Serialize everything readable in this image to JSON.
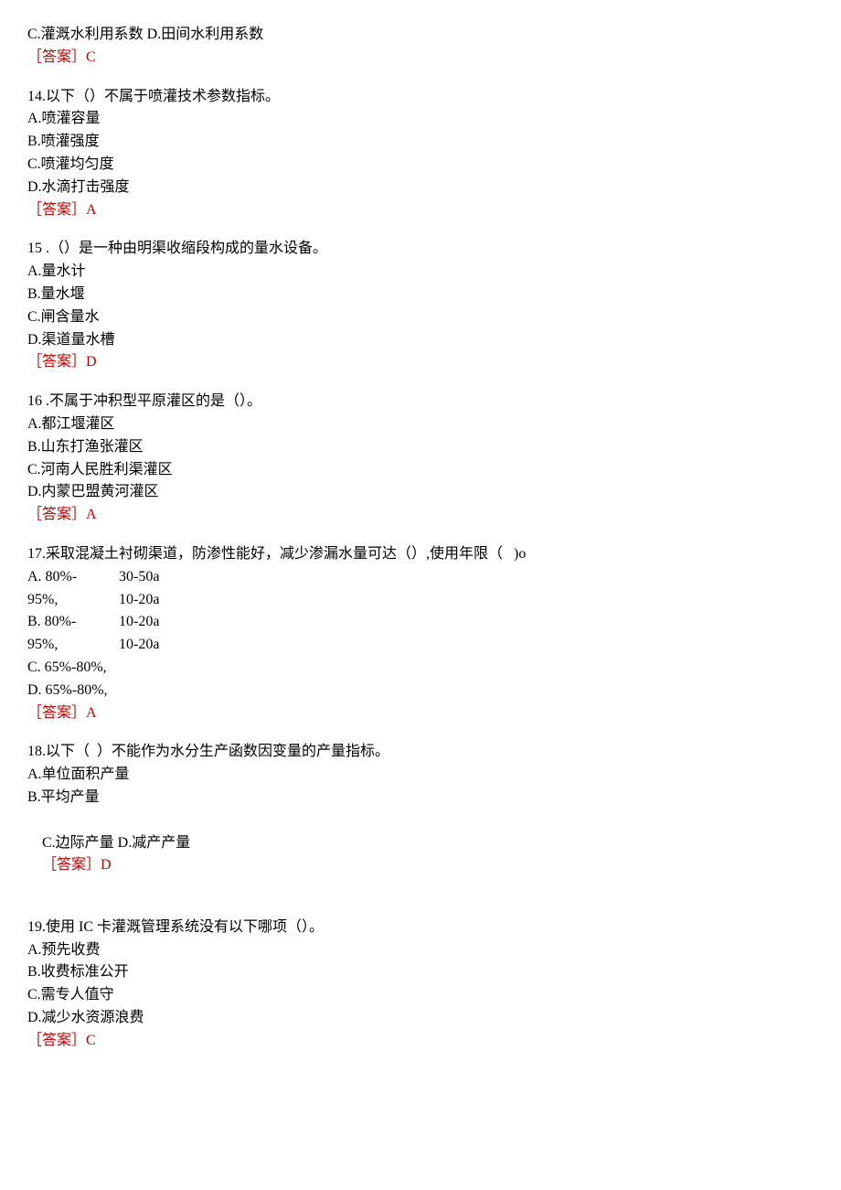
{
  "q13_tail": {
    "line_cd": "C.灌溉水利用系数 D.田间水利用系数",
    "answer": "［答案］C"
  },
  "q14": {
    "stem": "14.以下（）不属于喷灌技术参数指标。",
    "a": "A.喷灌容量",
    "b": "B.喷灌强度",
    "c": "C.喷灌均匀度",
    "d": "D.水滴打击强度",
    "answer": "［答案］A"
  },
  "q15": {
    "stem": "15 .（）是一种由明渠收缩段构成的量水设备。",
    "a": "A.量水计",
    "b": "B.量水堰",
    "c": "C.闸含量水",
    "d": "D.渠道量水槽",
    "answer": "［答案］D"
  },
  "q16": {
    "stem": "16 .不属于冲积型平原灌区的是（）。",
    "a": "A.都江堰灌区",
    "b": "B.山东打渔张灌区",
    "c": "C.河南人民胜利渠灌区",
    "d": "D.内蒙巴盟黄河灌区",
    "answer": "［答案］A"
  },
  "q17": {
    "stem": "17.采取混凝土衬砌渠道，防渗性能好，减少渗漏水量可达（）,使用年限（   )o",
    "col1": {
      "r1": "A. 80%-",
      "r2": "95%,",
      "r3": "B. 80%-",
      "r4": "95%,",
      "r5": "C. 65%-80%,",
      "r6": "D. 65%-80%,"
    },
    "col2": {
      "r1": "30-50a",
      "r2": "10-20a",
      "r3": "10-20a",
      "r4": "10-20a"
    },
    "answer": "［答案］A"
  },
  "q18": {
    "stem": "18.以下（  ）不能作为水分生产函数因变量的产量指标。",
    "a": "A.单位面积产量",
    "b": "B.平均产量",
    "cd_prefix": "C.边际产量 D.减产产量",
    "answer_inline": "［答案］D"
  },
  "q19": {
    "stem": "19.使用 IC 卡灌溉管理系统没有以下哪项（）。",
    "a": "A.预先收费",
    "b": "B.收费标准公开",
    "c": "C.需专人值守",
    "d": "D.减少水资源浪费",
    "answer": "［答案］C"
  }
}
